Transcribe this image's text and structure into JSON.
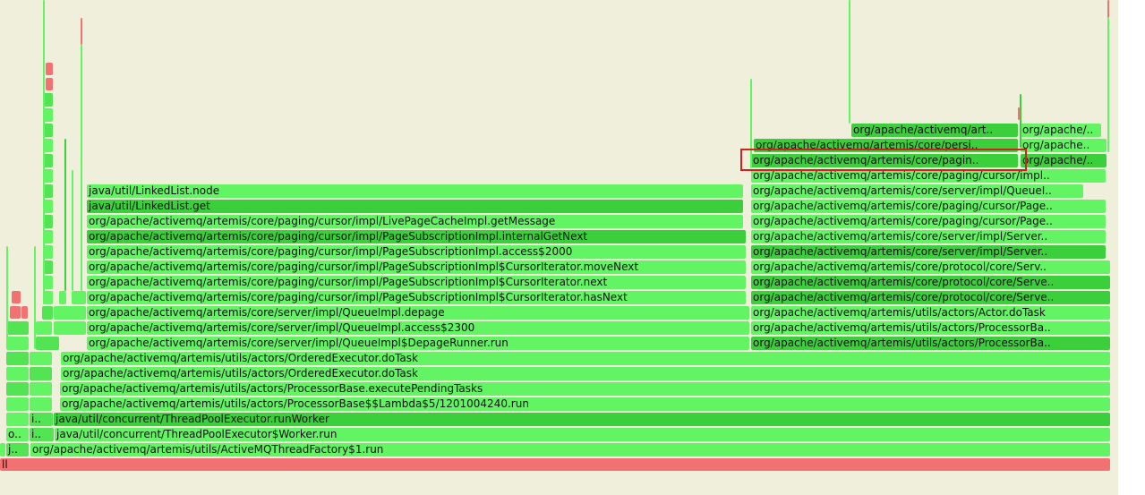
{
  "root_label": "ll",
  "left_stack": {
    "worker_prefix": "i..",
    "run_worker_prefix": "i..",
    "factory_prefix": "j..",
    "thread_prefix": "o.."
  },
  "frames": {
    "thread_factory_run": "org/apache/activemq/artemis/utils/ActiveMQThreadFactory$1.run",
    "worker_run": "java/util/concurrent/ThreadPoolExecutor$Worker.run",
    "run_worker": "java/util/concurrent/ThreadPoolExecutor.runWorker",
    "lambda_run": "org/apache/activemq/artemis/utils/actors/ProcessorBase$$Lambda$5/1201004240.run",
    "execute_pending_tasks": "org/apache/activemq/artemis/utils/actors/ProcessorBase.executePendingTasks",
    "ordered_executor_dotask_1": "org/apache/activemq/artemis/utils/actors/OrderedExecutor.doTask",
    "ordered_executor_dotask_2": "org/apache/activemq/artemis/utils/actors/OrderedExecutor.doTask",
    "depage_runner_run": "org/apache/activemq/artemis/core/server/impl/QueueImpl$DepageRunner.run",
    "queue_access": "org/apache/activemq/artemis/core/server/impl/QueueImpl.access$2300",
    "queue_depage": "org/apache/activemq/artemis/core/server/impl/QueueImpl.depage",
    "cursor_has_next": "org/apache/activemq/artemis/core/paging/cursor/impl/PageSubscriptionImpl$CursorIterator.hasNext",
    "cursor_next": "org/apache/activemq/artemis/core/paging/cursor/impl/PageSubscriptionImpl$CursorIterator.next",
    "cursor_move_next": "org/apache/activemq/artemis/core/paging/cursor/impl/PageSubscriptionImpl$CursorIterator.moveNext",
    "sub_access": "org/apache/activemq/artemis/core/paging/cursor/impl/PageSubscriptionImpl.access$2000",
    "sub_internal_get_next": "org/apache/activemq/artemis/core/paging/cursor/impl/PageSubscriptionImpl.internalGetNext",
    "live_page_get_message": "org/apache/activemq/artemis/core/paging/cursor/impl/LivePageCacheImpl.getMessage",
    "linked_list_get": "java/util/LinkedList.get",
    "linked_list_node": "java/util/LinkedList.node",
    "r_processor_base_1": "org/apache/activemq/artemis/utils/actors/ProcessorBa..",
    "r_processor_base_2": "org/apache/activemq/artemis/utils/actors/ProcessorBa..",
    "r_actor_dotask": "org/apache/activemq/artemis/utils/actors/Actor.doTask",
    "r_protocol_1": "org/apache/activemq/artemis/core/protocol/core/Serve..",
    "r_protocol_2": "org/apache/activemq/artemis/core/protocol/core/Serve..",
    "r_protocol_3": "org/apache/activemq/artemis/core/protocol/core/Serv..",
    "r_server_impl_1": "org/apache/activemq/artemis/core/server/impl/Server..",
    "r_server_impl_2": "org/apache/activemq/artemis/core/server/impl/Server..",
    "r_paging_cursor_page_1": "org/apache/activemq/artemis/core/paging/cursor/Page..",
    "r_paging_cursor_page_2": "org/apache/activemq/artemis/core/paging/cursor/Page..",
    "r_queue_impl": "org/apache/activemq/artemis/core/server/impl/QueueI..",
    "r_paging_cursor_impl": "org/apache/activemq/artemis/core/paging/cursor/impl..",
    "r_core_paging": "org/apache/activemq/artemis/core/pagin..",
    "r_core_persi": "org/apache/activemq/artemis/core/persi..",
    "r_art": "org/apache/activemq/art..",
    "rr_1": "org/apache/..",
    "rr_2": "org/apache..",
    "rr_3": "org/apache..",
    "rr_4": "org/apache/.."
  },
  "colors": {
    "background": "#f0efdc",
    "frame_light": "#62f462",
    "frame_dark": "#3bcf3b",
    "frame_red": "#f27272",
    "highlight_border": "#d32020"
  }
}
